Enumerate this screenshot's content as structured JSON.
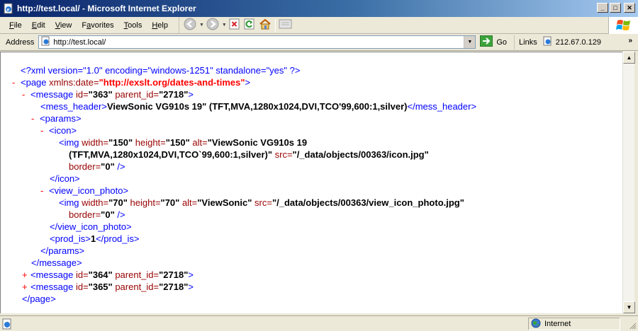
{
  "window": {
    "title": "http://test.local/ - Microsoft Internet Explorer",
    "controls": {
      "minimize": "_",
      "maximize": "□",
      "close": "✕"
    }
  },
  "menu": {
    "items": [
      {
        "label": "File",
        "accel": "F",
        "rest": "ile"
      },
      {
        "label": "Edit",
        "accel": "E",
        "rest": "dit"
      },
      {
        "label": "View",
        "accel": "V",
        "rest": "iew"
      },
      {
        "label": "Favorites",
        "accel": "a",
        "pre": "F",
        "rest": "vorites"
      },
      {
        "label": "Tools",
        "accel": "T",
        "rest": "ools"
      },
      {
        "label": "Help",
        "accel": "H",
        "rest": "elp"
      }
    ]
  },
  "toolbar": {
    "buttons": [
      "back-icon",
      "forward-icon",
      "stop-icon",
      "refresh-icon",
      "home-icon",
      "media-icon"
    ]
  },
  "address": {
    "label": "Address",
    "value": "http://test.local/",
    "go_label": "Go",
    "links_label": "Links",
    "link_item": "212.67.0.129"
  },
  "xml": {
    "pi": "<?xml version=\"1.0\" encoding=\"windows-1251\" standalone=\"yes\" ?>",
    "page_open_tag": "<page",
    "page_attr": " xmlns:date=",
    "page_ns": "\"http://exslt.org/dates-and-times\"",
    "page_close_bracket": ">",
    "message1_open": "<message",
    "message1_attr1": " id=",
    "message1_val1": "\"363\"",
    "message1_attr2": " parent_id=",
    "message1_val2": "\"2718\"",
    "message1_end": ">",
    "mess_header_open": "<mess_header>",
    "mess_header_text": "ViewSonic VG910s 19\" (TFT,MVA,1280x1024,DVI,TCO'99,600:1,silver)",
    "mess_header_close": "</mess_header>",
    "params_open": "<params>",
    "icon_open": "<icon>",
    "img1_open": "<img",
    "img1_a1": " width=",
    "img1_v1": "\"150\"",
    "img1_a2": " height=",
    "img1_v2": "\"150\"",
    "img1_a3": " alt=",
    "img1_v3a": "\"ViewSonic VG910s 19",
    "img1_v3b": "(TFT,MVA,1280x1024,DVI,TCO`99,600:1,silver)\"",
    "img1_a4": " src=",
    "img1_v4": "\"/_data/objects/00363/icon.jpg\"",
    "img1_a5": "border=",
    "img1_v5": "\"0\"",
    "img1_end": " />",
    "icon_close": "</icon>",
    "vip_open": "<view_icon_photo>",
    "img2_open": "<img",
    "img2_a1": " width=",
    "img2_v1": "\"70\"",
    "img2_a2": " height=",
    "img2_v2": "\"70\"",
    "img2_a3": " alt=",
    "img2_v3": "\"ViewSonic\"",
    "img2_a4": " src=",
    "img2_v4": "\"/_data/objects/00363/view_icon_photo.jpg\"",
    "img2_a5": "border=",
    "img2_v5": "\"0\"",
    "img2_end": " />",
    "vip_close": "</view_icon_photo>",
    "prod_is_open": "<prod_is>",
    "prod_is_text": "1",
    "prod_is_close": "</prod_is>",
    "params_close": "</params>",
    "message_close": "</message>",
    "message2_open": "<message",
    "message2_attr1": " id=",
    "message2_val1": "\"364\"",
    "message2_attr2": " parent_id=",
    "message2_val2": "\"2718\"",
    "message2_end": ">",
    "message3_open": "<message",
    "message3_attr1": " id=",
    "message3_val1": "\"365\"",
    "message3_attr2": " parent_id=",
    "message3_val2": "\"2718\"",
    "message3_end": ">",
    "page_close": "</page>",
    "minus": "-",
    "plus": "+"
  },
  "status": {
    "zone": "Internet"
  }
}
